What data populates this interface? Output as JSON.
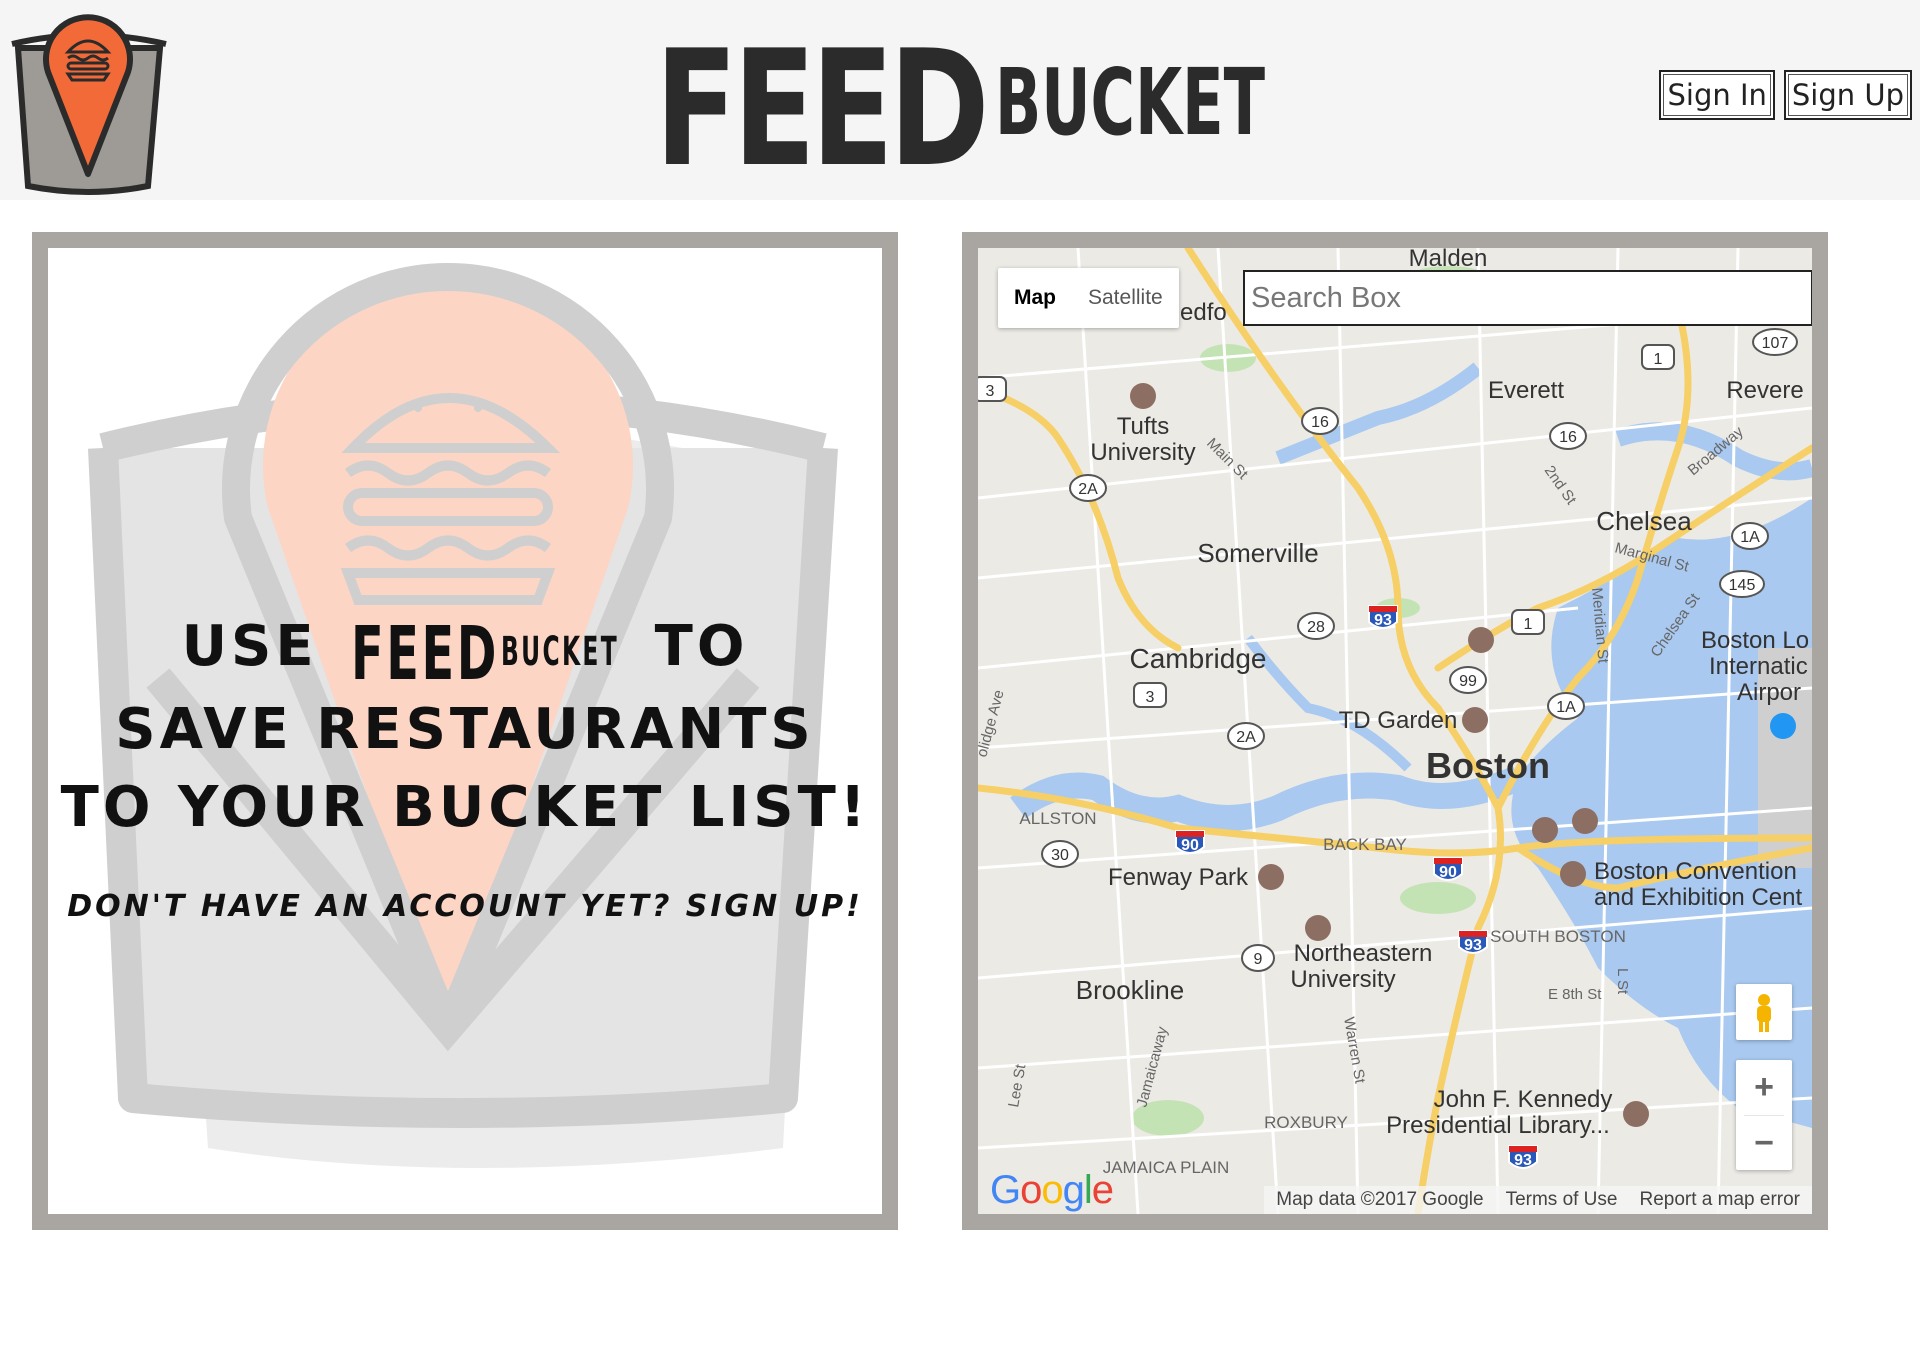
{
  "brand": {
    "name": "FEEDBUCKET",
    "name_big": "FEED",
    "name_small": "BUCKET"
  },
  "auth": {
    "sign_in": "Sign In",
    "sign_up": "Sign Up"
  },
  "promo": {
    "line1_pre": "Use",
    "line1_post": "to",
    "line2": "Save Restaurants",
    "line3": "to your Bucket List!",
    "signup": "Don't have an account yet? Sign up!"
  },
  "map": {
    "type_map": "Map",
    "type_satellite": "Satellite",
    "search_placeholder": "Search Box",
    "google": "Google",
    "attribution": {
      "data": "Map data ©2017 Google",
      "terms": "Terms of Use",
      "report": "Report a map error"
    },
    "places": {
      "malden": "Malden",
      "everett": "Everett",
      "revere": "Revere",
      "tufts": "Tufts",
      "university": "University",
      "somerville": "Somerville",
      "chelsea": "Chelsea",
      "cambridge": "Cambridge",
      "td_garden": "TD Garden",
      "boston": "Boston",
      "allston": "ALLSTON",
      "back_bay": "BACK BAY",
      "fenway": "Fenway Park",
      "northeastern": "Northeastern",
      "northeastern2": "University",
      "south_boston": "SOUTH BOSTON",
      "brookline": "Brookline",
      "roxbury": "ROXBURY",
      "jamaica_plain": "JAMAICA PLAIN",
      "jfk1": "John F. Kennedy",
      "jfk2": "Presidential Library...",
      "convention1": "Boston Convention",
      "convention2": "and Exhibition Cent",
      "airport1": "Boston Lo",
      "airport2": "Internatic",
      "airport3": "Airpor",
      "medford": "edfo",
      "main_st": "Main St",
      "second_st": "2nd St",
      "broadway": "Broadway",
      "marginal": "Marginal St",
      "meridian": "Meridian St",
      "chelsea_st": "Chelsea St",
      "eighth": "E 8th St",
      "l_st": "L St",
      "warren": "Warren St",
      "jamaicaway": "Jamaicaway",
      "lee_st": "Lee St",
      "oolidge": "olidge Ave"
    },
    "shields": {
      "i93": "93",
      "i90": "90",
      "r1": "1",
      "r16": "16",
      "r2a": "2A",
      "r28": "28",
      "r99": "99",
      "r1a": "1A",
      "r145": "145",
      "r107": "107",
      "r3": "3",
      "r30": "30",
      "r9": "9"
    }
  },
  "colors": {
    "header_bg": "#f5f5f5",
    "panel_frame": "#a9a6a1",
    "accent_orange": "#f26a38",
    "bucket_gray": "#9e9b96"
  }
}
